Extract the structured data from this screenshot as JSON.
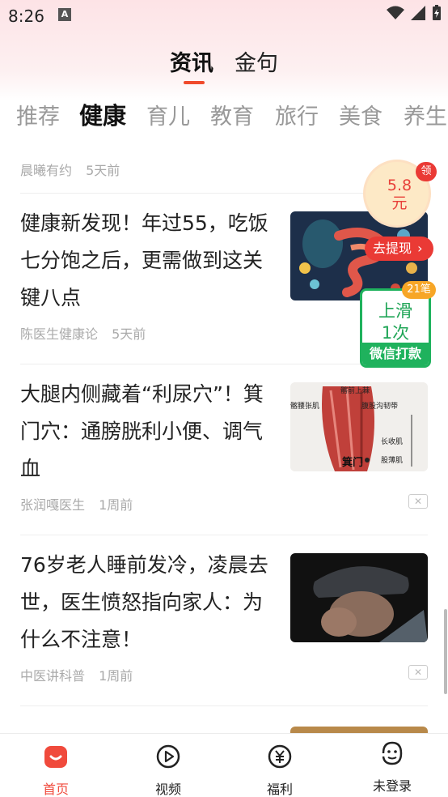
{
  "status_bar": {
    "time": "8:26",
    "notif_letter": "A"
  },
  "top_tabs": [
    "资讯",
    "金句"
  ],
  "categories": [
    "推荐",
    "健康",
    "育儿",
    "教育",
    "旅行",
    "美食",
    "养生"
  ],
  "prev_article_meta": {
    "author": "晨曦有约",
    "time": "5天前"
  },
  "articles": [
    {
      "title": "健康新发现！年过55，吃饭七分饱之后，更需做到这关键八点",
      "author": "陈医生健康论",
      "time": "5天前"
    },
    {
      "title": "大腿内侧藏着“利尿穴”！箕门穴：通膀胱利小便、调气血",
      "author": "张润嘎医生",
      "time": "1周前",
      "thumb_labels": [
        "髂前上棘",
        "腹股沟韧带",
        "髂腰张肌",
        "长收肌",
        "股薄肌",
        "箕门"
      ]
    },
    {
      "title": "76岁老人睡前发冷，凌晨去世，医生愤怒指向家人：为什么不注意！",
      "author": "中医讲科普",
      "time": "1周前"
    }
  ],
  "promo": {
    "coin_value": "5.8",
    "coin_unit": "元",
    "ling": "领",
    "withdraw": "去提现",
    "badge": "21笔",
    "slide_line1": "上滑",
    "slide_line2": "1次",
    "slide_bottom": "微信打款"
  },
  "bottom_nav": [
    {
      "label": "首页",
      "icon": "home-icon",
      "active": true
    },
    {
      "label": "视频",
      "icon": "video-icon",
      "active": false
    },
    {
      "label": "福利",
      "icon": "yuan-icon",
      "active": false
    },
    {
      "label": "未登录",
      "icon": "user-face-icon",
      "active": false
    }
  ],
  "colors": {
    "accent": "#f04a3c",
    "green": "#1fb25d",
    "underline": "#f04a2c"
  }
}
